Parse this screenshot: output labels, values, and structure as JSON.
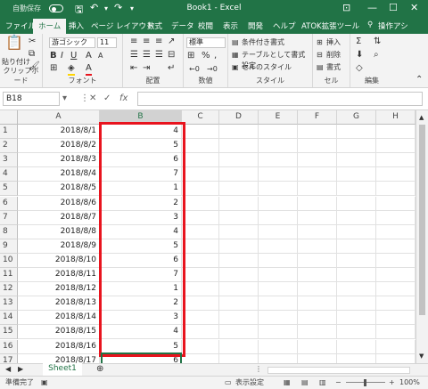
{
  "titlebar": {
    "autosave": "自動保存",
    "title": "Book1 - Excel",
    "colors": {
      "brand": "#217346"
    }
  },
  "tabs": [
    "ファイル",
    "ホーム",
    "挿入",
    "ページ レイアウト",
    "数式",
    "データ",
    "校閲",
    "表示",
    "開発",
    "ヘルプ",
    "ATOK拡張ツール",
    "操作アシ"
  ],
  "ribbon": {
    "clipboard": {
      "label": "クリップボード",
      "paste": "貼り付け"
    },
    "font": {
      "label": "フォント",
      "name": "游ゴシック",
      "size": "11"
    },
    "alignment": {
      "label": "配置"
    },
    "number": {
      "label": "数値",
      "format": "標準"
    },
    "styles": {
      "label": "スタイル",
      "conditional": "条件付き書式",
      "table": "テーブルとして書式設定",
      "cell": "セルのスタイル"
    },
    "cells": {
      "label": "セル",
      "insert": "挿入",
      "delete": "削除",
      "format": "書式"
    },
    "editing": {
      "label": "編集"
    }
  },
  "formula": {
    "namebox": "B18",
    "fx": "fx",
    "value": ""
  },
  "columns": [
    "A",
    "B",
    "C",
    "D",
    "E",
    "F",
    "G",
    "H"
  ],
  "rows": [
    {
      "n": "1",
      "a": "2018/8/1",
      "b": "4"
    },
    {
      "n": "2",
      "a": "2018/8/2",
      "b": "5"
    },
    {
      "n": "3",
      "a": "2018/8/3",
      "b": "6"
    },
    {
      "n": "4",
      "a": "2018/8/4",
      "b": "7"
    },
    {
      "n": "5",
      "a": "2018/8/5",
      "b": "1"
    },
    {
      "n": "6",
      "a": "2018/8/6",
      "b": "2"
    },
    {
      "n": "7",
      "a": "2018/8/7",
      "b": "3"
    },
    {
      "n": "8",
      "a": "2018/8/8",
      "b": "4"
    },
    {
      "n": "9",
      "a": "2018/8/9",
      "b": "5"
    },
    {
      "n": "10",
      "a": "2018/8/10",
      "b": "6"
    },
    {
      "n": "11",
      "a": "2018/8/11",
      "b": "7"
    },
    {
      "n": "12",
      "a": "2018/8/12",
      "b": "1"
    },
    {
      "n": "13",
      "a": "2018/8/13",
      "b": "2"
    },
    {
      "n": "14",
      "a": "2018/8/14",
      "b": "3"
    },
    {
      "n": "15",
      "a": "2018/8/15",
      "b": "4"
    },
    {
      "n": "16",
      "a": "2018/8/16",
      "b": "5"
    },
    {
      "n": "17",
      "a": "2018/8/17",
      "b": "6"
    },
    {
      "n": "18",
      "a": "",
      "b": ""
    }
  ],
  "sheet": {
    "tab": "Sheet1"
  },
  "status": {
    "ready": "準備完了",
    "display_settings": "表示設定",
    "zoom": "100%"
  }
}
